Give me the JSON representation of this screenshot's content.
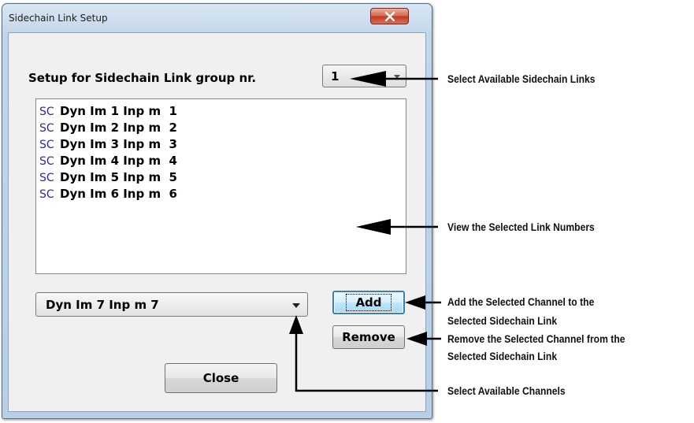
{
  "window": {
    "title": "Sidechain Link Setup",
    "close_glyph": "x"
  },
  "setup": {
    "label": "Setup for Sidechain Link group nr.",
    "group_value": "1"
  },
  "links": {
    "icon_text": "SC",
    "items": [
      "Dyn Im 1 Inp m  1",
      "Dyn Im 2 Inp m  2",
      "Dyn Im 3 Inp m  3",
      "Dyn Im 4 Inp m  4",
      "Dyn Im 5 Inp m  5",
      "Dyn Im 6 Inp m  6"
    ]
  },
  "channel_select": {
    "value": "Dyn Im 7 Inp m  7"
  },
  "buttons": {
    "add": "Add",
    "remove": "Remove",
    "close": "Close"
  },
  "annotations": {
    "select_links": "Select Available Sidechain Links",
    "view_numbers": "View the Selected Link Numbers",
    "add_line1": "Add the Selected Channel to the",
    "add_line2": "Selected Sidechain Link",
    "remove_line1": "Remove the Selected Channel from the",
    "remove_line2": "Selected Sidechain Link",
    "select_channels": "Select Available Channels"
  },
  "colors": {
    "accent": "#3c7fb1",
    "close_button": "#c0391f",
    "sc_icon": "#2a2a9e"
  }
}
